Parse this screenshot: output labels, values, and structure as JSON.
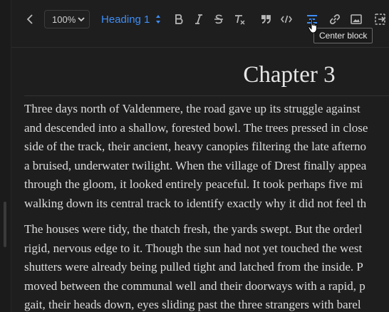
{
  "toolbar": {
    "zoom": "100%",
    "block_style": "Heading 1",
    "tooltip": "Center block",
    "icons": [
      "chevron-left-icon",
      "bold-icon",
      "italic-icon",
      "strikethrough-icon",
      "clear-format-icon",
      "quote-icon",
      "code-icon",
      "align-center-icon",
      "link-icon",
      "image-icon",
      "embed-icon"
    ],
    "accent_color": "#3e8ef7"
  },
  "document": {
    "chapter_title": "Chapter 3",
    "paragraphs": [
      {
        "lines": [
          "Three days north of Valdenmere, the road gave up its struggle against",
          "and descended into a shallow, forested bowl. The trees pressed in close",
          "side of the track, their ancient, heavy canopies filtering the late afterno",
          "a bruised, underwater twilight. When the village of Drest finally appea",
          "through the gloom, it looked entirely peaceful. It took perhaps five mi",
          "walking down its central track to identify exactly why it did not feel th"
        ]
      },
      {
        "lines": [
          "The houses were tidy, the thatch fresh, the yards swept. But the orderl",
          "rigid, nervous edge to it. Though the sun had not yet touched the west",
          "shutters were already being pulled tight and latched from the inside. P",
          "moved between the communal well and their doorways with a rapid, p",
          "gait, their heads down, eyes sliding past the three strangers with barel"
        ]
      }
    ]
  }
}
